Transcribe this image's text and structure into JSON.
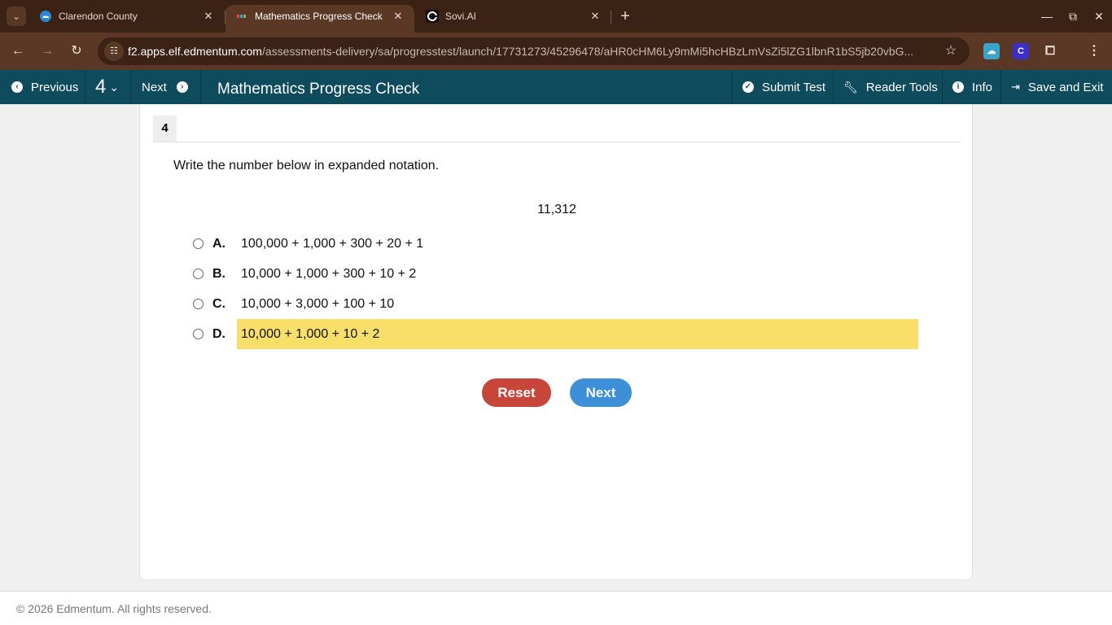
{
  "browser": {
    "tabs": [
      {
        "title": "Clarendon County",
        "active": false
      },
      {
        "title": "Mathematics Progress Check",
        "active": true
      },
      {
        "title": "Sovi.AI",
        "active": false
      }
    ],
    "url_domain": "f2.apps.elf.edmentum.com",
    "url_path": "/assessments-delivery/sa/progresstest/launch/17731273/45296478/aHR0cHM6Ly9mMi5hcHBzLmVsZi5lZG1lbnR1bS5jb20vbG..."
  },
  "appbar": {
    "previous_label": "Previous",
    "question_number": "4",
    "next_label": "Next",
    "title": "Mathematics Progress Check",
    "submit_label": "Submit Test",
    "reader_tools_label": "Reader Tools",
    "info_label": "Info",
    "save_exit_label": "Save and Exit"
  },
  "question": {
    "number": "4",
    "prompt": "Write the number below in expanded notation.",
    "value": "11,312",
    "options": [
      {
        "letter": "A.",
        "text": "100,000 + 1,000 + 300 + 20 + 1",
        "highlighted": false
      },
      {
        "letter": "B.",
        "text": "10,000 + 1,000 + 300 + 10 + 2",
        "highlighted": false
      },
      {
        "letter": "C.",
        "text": "10,000 + 3,000 + 100 + 10",
        "highlighted": false
      },
      {
        "letter": "D.",
        "text": "10,000 + 1,000 + 10 + 2",
        "highlighted": true
      }
    ],
    "reset_label": "Reset",
    "next_label": "Next"
  },
  "footer": {
    "copyright": "© 2026 Edmentum. All rights reserved."
  },
  "colors": {
    "appbar": "#0e4b5d",
    "highlight": "#f7df6a",
    "reset_button": "#c8453a",
    "next_button": "#3d8fd7"
  }
}
